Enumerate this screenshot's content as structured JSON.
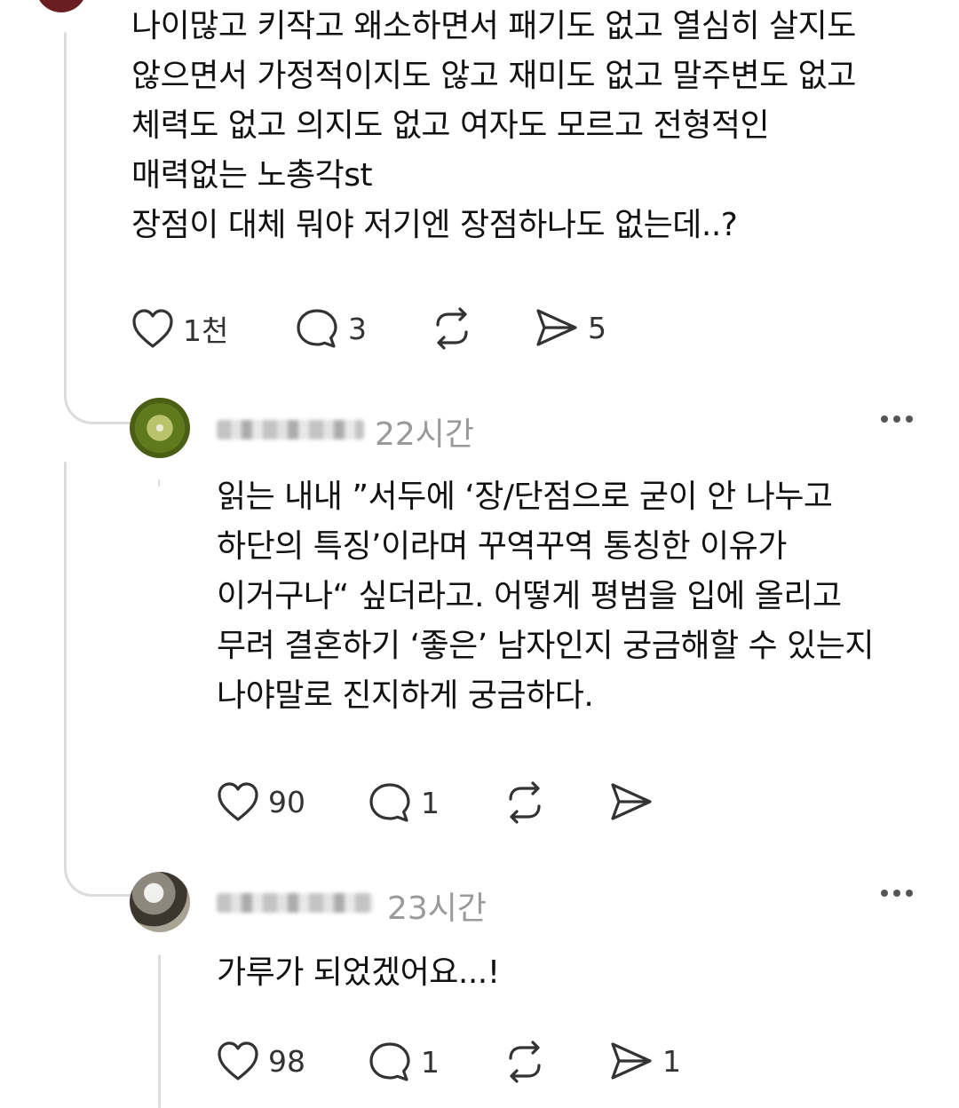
{
  "main_post": {
    "text": "나이많고 키작고 왜소하면서 패기도 없고 열심히 살지도\n않으면서 가정적이지도 않고 재미도 없고 말주변도 없고\n체력도 없고 의지도 없고 여자도 모르고 전형적인\n매력없는 노총각st\n장점이 대체 뭐야 저기엔 장점하나도 없는데..?",
    "like_count": "1천",
    "reply_count": "3",
    "share_count": "5"
  },
  "replies": [
    {
      "time": "22시간",
      "text": "읽는 내내 ”서두에 ‘장/단점으로 굳이 안 나누고\n하단의 특징’이라며 꾸역꾸역 통칭한 이유가\n이거구나“ 싶더라고. 어떻게 평범을 입에 올리고\n무려 결혼하기 ‘좋은’ 남자인지 궁금해할 수 있는지\n나야말로 진지하게 궁금하다.",
      "like_count": "90",
      "reply_count": "1",
      "share_count": ""
    },
    {
      "time": "23시간",
      "text": "가루가 되었겠어요...!",
      "like_count": "98",
      "reply_count": "1",
      "share_count": "1"
    }
  ],
  "icons": {
    "like": "heart-icon",
    "reply": "comment-bubble-icon",
    "repost": "repost-icon",
    "share": "send-icon",
    "more": "more-horizontal-icon"
  },
  "colors": {
    "text": "#111111",
    "muted": "#9a9a9a",
    "icon": "#333333",
    "thread_line": "#dcdcdc"
  }
}
